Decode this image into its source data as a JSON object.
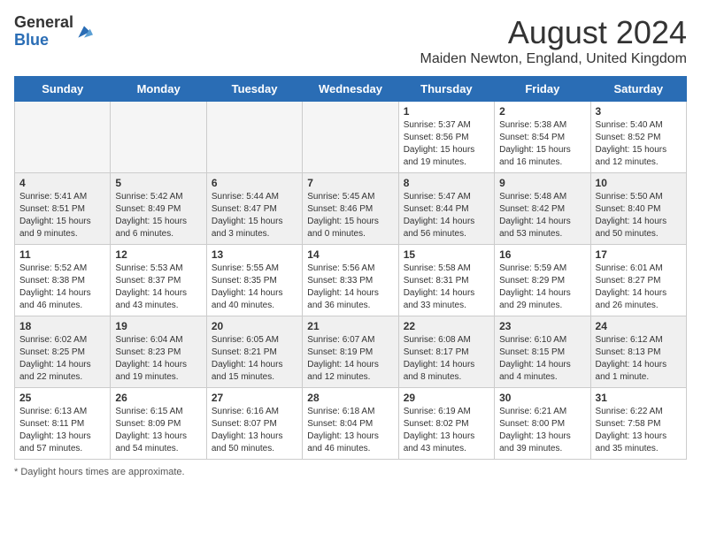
{
  "header": {
    "logo_line1": "General",
    "logo_line2": "Blue",
    "title": "August 2024",
    "subtitle": "Maiden Newton, England, United Kingdom"
  },
  "days": [
    "Sunday",
    "Monday",
    "Tuesday",
    "Wednesday",
    "Thursday",
    "Friday",
    "Saturday"
  ],
  "weeks": [
    [
      {
        "date": "",
        "text": ""
      },
      {
        "date": "",
        "text": ""
      },
      {
        "date": "",
        "text": ""
      },
      {
        "date": "",
        "text": ""
      },
      {
        "date": "1",
        "text": "Sunrise: 5:37 AM\nSunset: 8:56 PM\nDaylight: 15 hours and 19 minutes."
      },
      {
        "date": "2",
        "text": "Sunrise: 5:38 AM\nSunset: 8:54 PM\nDaylight: 15 hours and 16 minutes."
      },
      {
        "date": "3",
        "text": "Sunrise: 5:40 AM\nSunset: 8:52 PM\nDaylight: 15 hours and 12 minutes."
      }
    ],
    [
      {
        "date": "4",
        "text": "Sunrise: 5:41 AM\nSunset: 8:51 PM\nDaylight: 15 hours and 9 minutes."
      },
      {
        "date": "5",
        "text": "Sunrise: 5:42 AM\nSunset: 8:49 PM\nDaylight: 15 hours and 6 minutes."
      },
      {
        "date": "6",
        "text": "Sunrise: 5:44 AM\nSunset: 8:47 PM\nDaylight: 15 hours and 3 minutes."
      },
      {
        "date": "7",
        "text": "Sunrise: 5:45 AM\nSunset: 8:46 PM\nDaylight: 15 hours and 0 minutes."
      },
      {
        "date": "8",
        "text": "Sunrise: 5:47 AM\nSunset: 8:44 PM\nDaylight: 14 hours and 56 minutes."
      },
      {
        "date": "9",
        "text": "Sunrise: 5:48 AM\nSunset: 8:42 PM\nDaylight: 14 hours and 53 minutes."
      },
      {
        "date": "10",
        "text": "Sunrise: 5:50 AM\nSunset: 8:40 PM\nDaylight: 14 hours and 50 minutes."
      }
    ],
    [
      {
        "date": "11",
        "text": "Sunrise: 5:52 AM\nSunset: 8:38 PM\nDaylight: 14 hours and 46 minutes."
      },
      {
        "date": "12",
        "text": "Sunrise: 5:53 AM\nSunset: 8:37 PM\nDaylight: 14 hours and 43 minutes."
      },
      {
        "date": "13",
        "text": "Sunrise: 5:55 AM\nSunset: 8:35 PM\nDaylight: 14 hours and 40 minutes."
      },
      {
        "date": "14",
        "text": "Sunrise: 5:56 AM\nSunset: 8:33 PM\nDaylight: 14 hours and 36 minutes."
      },
      {
        "date": "15",
        "text": "Sunrise: 5:58 AM\nSunset: 8:31 PM\nDaylight: 14 hours and 33 minutes."
      },
      {
        "date": "16",
        "text": "Sunrise: 5:59 AM\nSunset: 8:29 PM\nDaylight: 14 hours and 29 minutes."
      },
      {
        "date": "17",
        "text": "Sunrise: 6:01 AM\nSunset: 8:27 PM\nDaylight: 14 hours and 26 minutes."
      }
    ],
    [
      {
        "date": "18",
        "text": "Sunrise: 6:02 AM\nSunset: 8:25 PM\nDaylight: 14 hours and 22 minutes."
      },
      {
        "date": "19",
        "text": "Sunrise: 6:04 AM\nSunset: 8:23 PM\nDaylight: 14 hours and 19 minutes."
      },
      {
        "date": "20",
        "text": "Sunrise: 6:05 AM\nSunset: 8:21 PM\nDaylight: 14 hours and 15 minutes."
      },
      {
        "date": "21",
        "text": "Sunrise: 6:07 AM\nSunset: 8:19 PM\nDaylight: 14 hours and 12 minutes."
      },
      {
        "date": "22",
        "text": "Sunrise: 6:08 AM\nSunset: 8:17 PM\nDaylight: 14 hours and 8 minutes."
      },
      {
        "date": "23",
        "text": "Sunrise: 6:10 AM\nSunset: 8:15 PM\nDaylight: 14 hours and 4 minutes."
      },
      {
        "date": "24",
        "text": "Sunrise: 6:12 AM\nSunset: 8:13 PM\nDaylight: 14 hours and 1 minute."
      }
    ],
    [
      {
        "date": "25",
        "text": "Sunrise: 6:13 AM\nSunset: 8:11 PM\nDaylight: 13 hours and 57 minutes."
      },
      {
        "date": "26",
        "text": "Sunrise: 6:15 AM\nSunset: 8:09 PM\nDaylight: 13 hours and 54 minutes."
      },
      {
        "date": "27",
        "text": "Sunrise: 6:16 AM\nSunset: 8:07 PM\nDaylight: 13 hours and 50 minutes."
      },
      {
        "date": "28",
        "text": "Sunrise: 6:18 AM\nSunset: 8:04 PM\nDaylight: 13 hours and 46 minutes."
      },
      {
        "date": "29",
        "text": "Sunrise: 6:19 AM\nSunset: 8:02 PM\nDaylight: 13 hours and 43 minutes."
      },
      {
        "date": "30",
        "text": "Sunrise: 6:21 AM\nSunset: 8:00 PM\nDaylight: 13 hours and 39 minutes."
      },
      {
        "date": "31",
        "text": "Sunrise: 6:22 AM\nSunset: 7:58 PM\nDaylight: 13 hours and 35 minutes."
      }
    ]
  ],
  "note": "Daylight hours"
}
